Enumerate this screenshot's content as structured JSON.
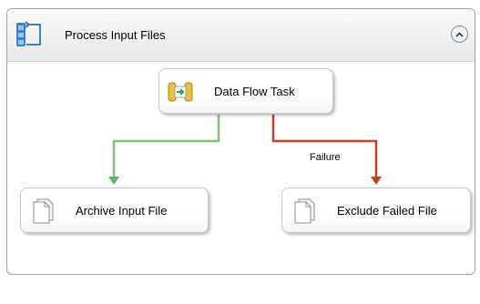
{
  "container": {
    "title": "Process Input Files",
    "icon": "sequence-container-icon",
    "collapse_icon": "chevron-up-icon"
  },
  "tasks": {
    "data_flow": {
      "label": "Data Flow Task",
      "icon": "data-flow-task-icon"
    },
    "archive": {
      "label": "Archive Input File",
      "icon": "file-system-task-icon"
    },
    "exclude": {
      "label": "Exclude Failed File",
      "icon": "file-system-task-icon"
    }
  },
  "constraints": {
    "success": {
      "color": "#5cb85c"
    },
    "failure": {
      "label": "Failure",
      "color": "#c0451b"
    }
  }
}
